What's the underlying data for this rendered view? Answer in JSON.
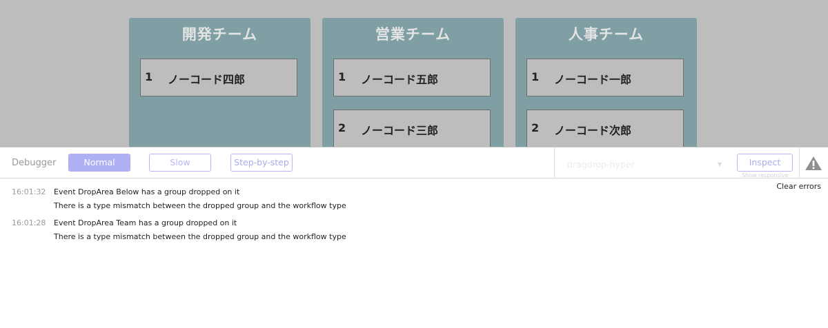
{
  "canvas": {
    "teams": [
      {
        "title": "開発チーム",
        "members": [
          {
            "num": "1",
            "name": "ノーコード四郎"
          }
        ]
      },
      {
        "title": "営業チーム",
        "members": [
          {
            "num": "1",
            "name": "ノーコード五郎"
          },
          {
            "num": "2",
            "name": "ノーコード三郎"
          }
        ]
      },
      {
        "title": "人事チーム",
        "members": [
          {
            "num": "1",
            "name": "ノーコード一郎"
          },
          {
            "num": "2",
            "name": "ノーコード次郎"
          }
        ]
      }
    ]
  },
  "debugger": {
    "label": "Debugger",
    "modes": {
      "normal": "Normal",
      "slow": "Slow",
      "step": "Step-by-step"
    },
    "active_mode": "Normal",
    "element_select": "dragdrop-hyper",
    "inspect_label": "Inspect",
    "show_responsive": "Show responsive",
    "warning_icon": "warning-icon"
  },
  "log": {
    "clear_label": "Clear errors",
    "entries": [
      {
        "time": "16:01:32",
        "event": "Event DropArea Below has a group dropped on it",
        "error": "There is a type mismatch between the dropped group and the workflow type"
      },
      {
        "time": "16:01:28",
        "event": "Event DropArea Team has a group dropped on it",
        "error": "There is a type mismatch between the dropped group and the workflow type"
      }
    ]
  },
  "colors": {
    "canvas_bg": "#bdbdbd",
    "team_bg": "#7f9fa4",
    "accent": "#aeb0f3"
  }
}
